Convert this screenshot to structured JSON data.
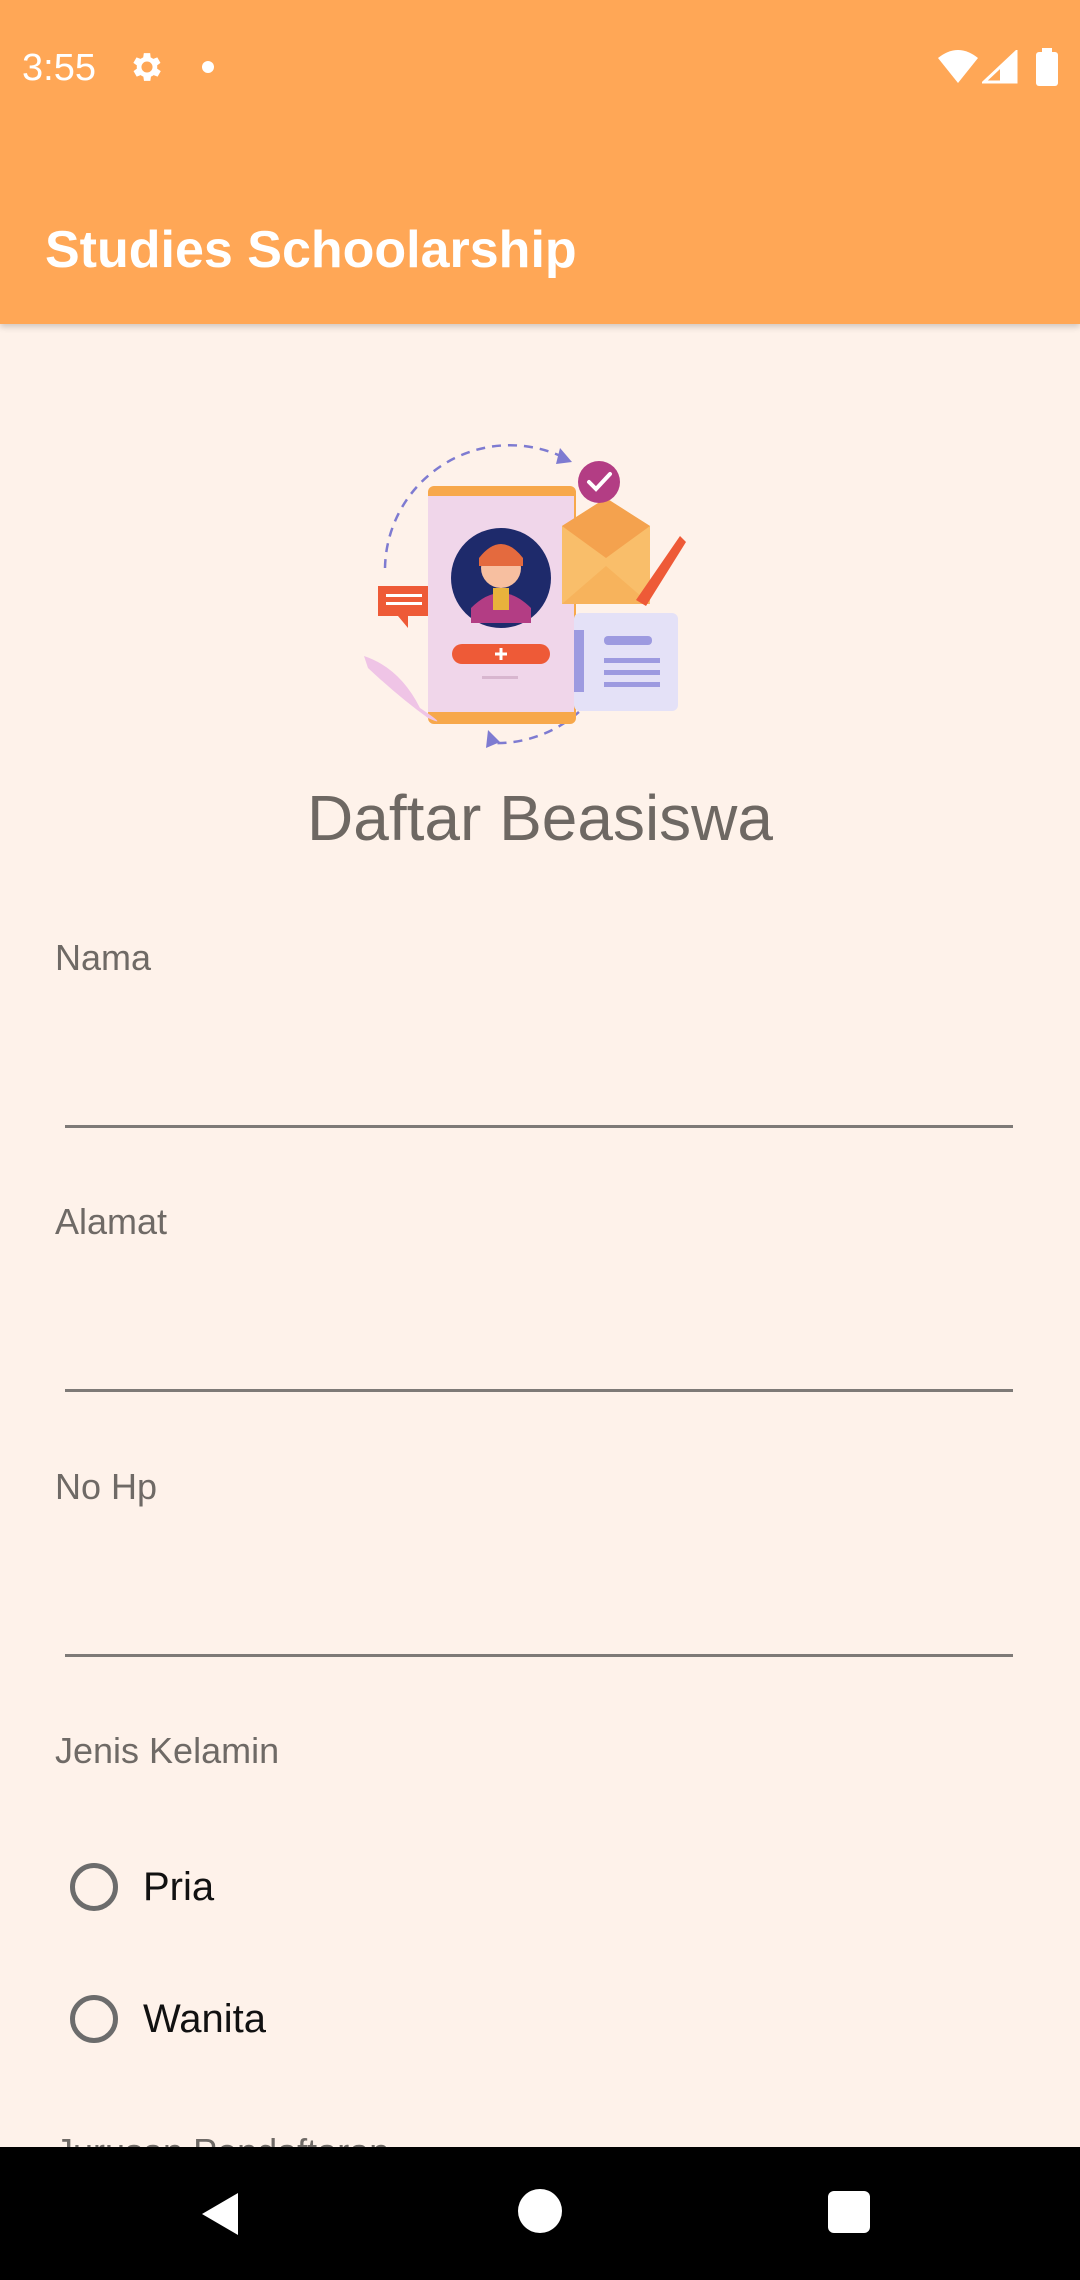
{
  "status_bar": {
    "time": "3:55",
    "icons": [
      "gear-icon",
      "notification-dot-icon",
      "wifi-icon",
      "signal-icon",
      "battery-icon"
    ]
  },
  "app_bar": {
    "title": "Studies Schoolarship",
    "background": "#FFA756"
  },
  "illustration": {
    "icon": "registration-illustration"
  },
  "form": {
    "heading": "Daftar Beasiswa",
    "fields": [
      {
        "label": "Nama",
        "value": ""
      },
      {
        "label": "Alamat",
        "value": ""
      },
      {
        "label": "No Hp",
        "value": ""
      }
    ],
    "gender": {
      "label": "Jenis Kelamin",
      "options": [
        "Pria",
        "Wanita"
      ]
    },
    "next_label_partial": "Jurusan Pendaftaran"
  },
  "nav_bar": {
    "icons": [
      "back-icon",
      "home-icon",
      "recent-apps-icon"
    ]
  },
  "colors": {
    "background": "#FEF2EA",
    "accent": "#FFA756"
  }
}
